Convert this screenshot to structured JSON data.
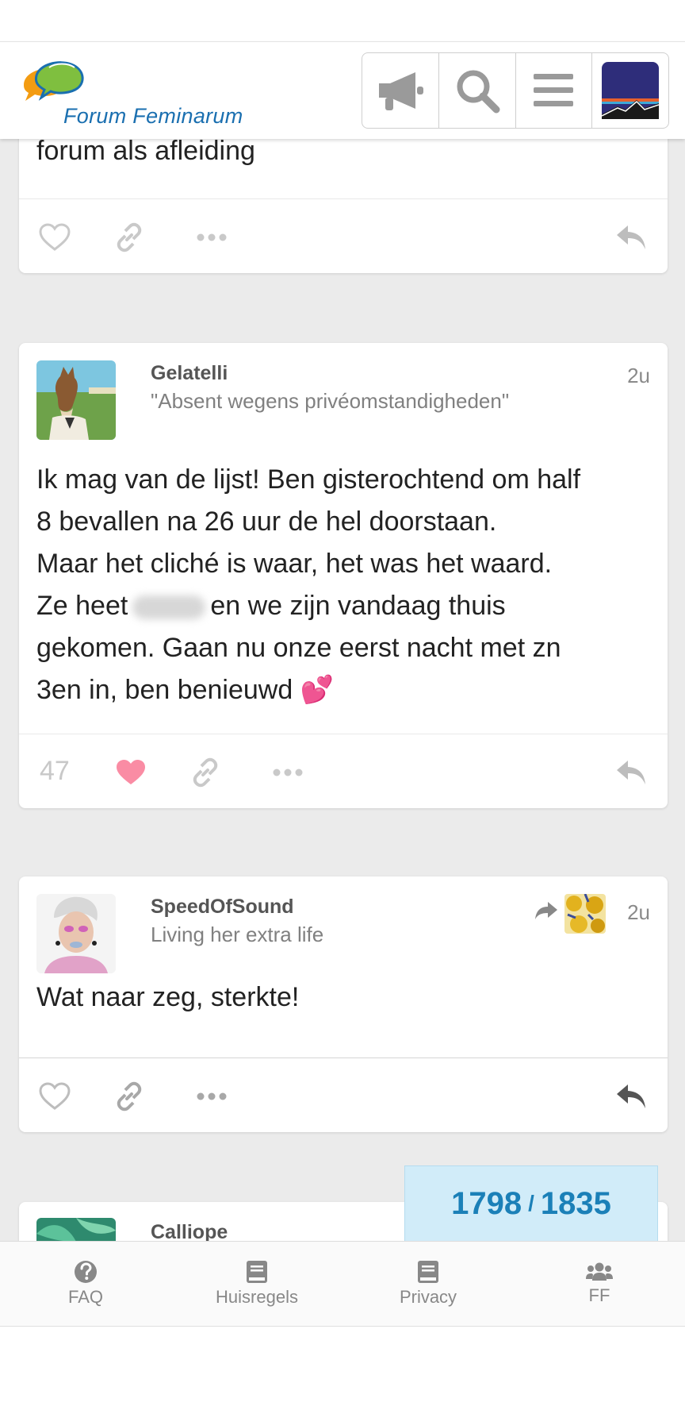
{
  "header": {
    "brand": "Forum Feminarum",
    "icons": [
      "megaphone-icon",
      "search-icon",
      "hamburger-menu-icon",
      "user-avatar"
    ]
  },
  "posts": [
    {
      "body_tail": "forum als afleiding",
      "like_count": "",
      "liked": false
    },
    {
      "username": "Gelatelli",
      "user_title": "\"Absent wegens privéomstandigheden\"",
      "time": "2u",
      "body_lines": [
        "Ik mag van de lijst! Ben gisterochtend om half",
        "8 bevallen na 26 uur de hel doorstaan.",
        "Maar het cliché is waar, het was het waard.",
        "Ze heet",
        "en we zijn vandaag thuis",
        "gekomen. Gaan nu onze eerst nacht met zn",
        "3en in, ben benieuwd"
      ],
      "emoji": "💕",
      "like_count": "47",
      "liked": true
    },
    {
      "username": "SpeedOfSound",
      "user_title": "Living her extra life",
      "time": "2u",
      "body": "Wat naar zeg, sterkte!",
      "liked": false
    },
    {
      "username": "Calliope"
    }
  ],
  "progress": {
    "current": "1798",
    "separator": "/",
    "total": "1835"
  },
  "footer": {
    "items": [
      {
        "label": "FAQ",
        "icon": "question-circle-icon"
      },
      {
        "label": "Huisregels",
        "icon": "book-icon"
      },
      {
        "label": "Privacy",
        "icon": "book-icon"
      },
      {
        "label": "FF",
        "icon": "users-icon"
      }
    ]
  },
  "colors": {
    "brand_blue": "#1a6fb0",
    "like_pink": "#fa6c8d",
    "progress_bg": "#d1ecf9",
    "progress_text": "#1b80b8"
  }
}
